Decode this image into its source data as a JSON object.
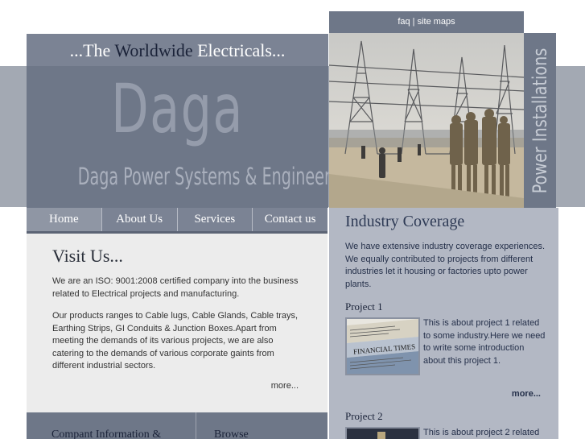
{
  "header": {
    "tagline_pre": "...The ",
    "tagline_highlight": "Worldwide",
    "tagline_post": " Electricals...",
    "brand": "Daga",
    "company": "Daga Power Systems & Engineers"
  },
  "toplinks": {
    "faq": "faq",
    "separator": " | ",
    "sitemaps": "site maps"
  },
  "side_tab": "Power Installations",
  "nav": {
    "items": [
      "Home",
      "About Us",
      "Services",
      "Contact us"
    ],
    "active": "Home"
  },
  "visit": {
    "title": "Visit Us...",
    "p1": "We are an ISO: 9001:2008 certified company into the business related to Electrical projects and manufacturing.",
    "p2": "Our products ranges to Cable lugs, Cable Glands, Cable trays, Earthing Strips, GI Conduits & Junction Boxes.Apart from meeting the demands of its various projects, we are also catering to the demands of various corporate gaints from different industrial sectors.",
    "more": "more..."
  },
  "footer": {
    "col1": "Compant Information &",
    "col2": "Browse"
  },
  "industry": {
    "title": "Industry Coverage",
    "intro": "We have extensive industry coverage experiences. We equally contributed to projects from different industries let it housing or factories upto power plants.",
    "projects": [
      {
        "title": "Project 1",
        "desc": "This is about project 1 related to some industry.Here we need to write some introduction about this project 1.",
        "more": "more..."
      },
      {
        "title": "Project 2",
        "desc": "This is about project 2 related"
      }
    ],
    "thumb1_text": "FINANCIAL TIMES"
  },
  "colors": {
    "header": "#6e7788",
    "band": "#a3a9b3",
    "panel": "#b3b8c4",
    "content_bg": "#ececec",
    "title_dark": "#1a2238"
  },
  "icons": [
    "power-installation-photo",
    "newspaper-thumbnail",
    "project2-thumbnail"
  ]
}
